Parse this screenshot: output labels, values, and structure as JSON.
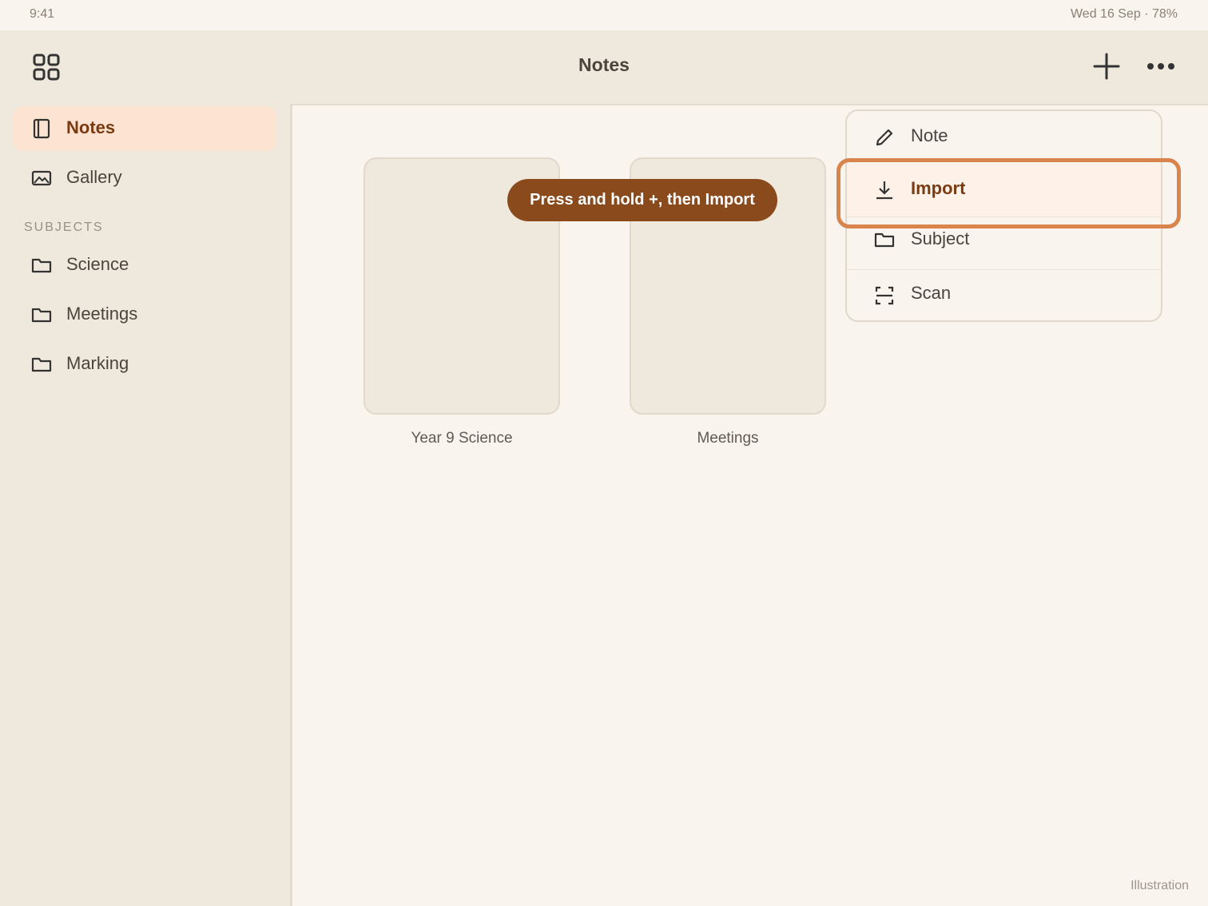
{
  "status": {
    "time": "9:41",
    "right": "Wed 16 Sep · 78%"
  },
  "topbar": {
    "title": "Notes"
  },
  "sidebar": {
    "items": [
      {
        "label": "Notes",
        "icon": "notebook-icon"
      },
      {
        "label": "Gallery",
        "icon": "image-icon"
      }
    ],
    "section_label": "SUBJECTS",
    "subjects": [
      {
        "label": "Science",
        "icon": "folder-icon"
      },
      {
        "label": "Meetings",
        "icon": "folder-icon"
      },
      {
        "label": "Marking",
        "icon": "folder-icon"
      }
    ]
  },
  "main": {
    "cards": [
      {
        "label": "Year 9 Science"
      },
      {
        "label": "Meetings"
      }
    ],
    "hint": "Press and hold +, then Import"
  },
  "menu": {
    "items": [
      {
        "label": "Note",
        "icon": "pencil-icon"
      },
      {
        "label": "Import",
        "icon": "download-icon"
      },
      {
        "label": "Subject",
        "icon": "folder-icon"
      },
      {
        "label": "Scan",
        "icon": "scan-icon"
      }
    ]
  },
  "watermark": "Illustration",
  "colors": {
    "accent": "#8b4a1c",
    "highlight_ring": "#d9834d",
    "sidebar_bg": "#efe8dc"
  }
}
